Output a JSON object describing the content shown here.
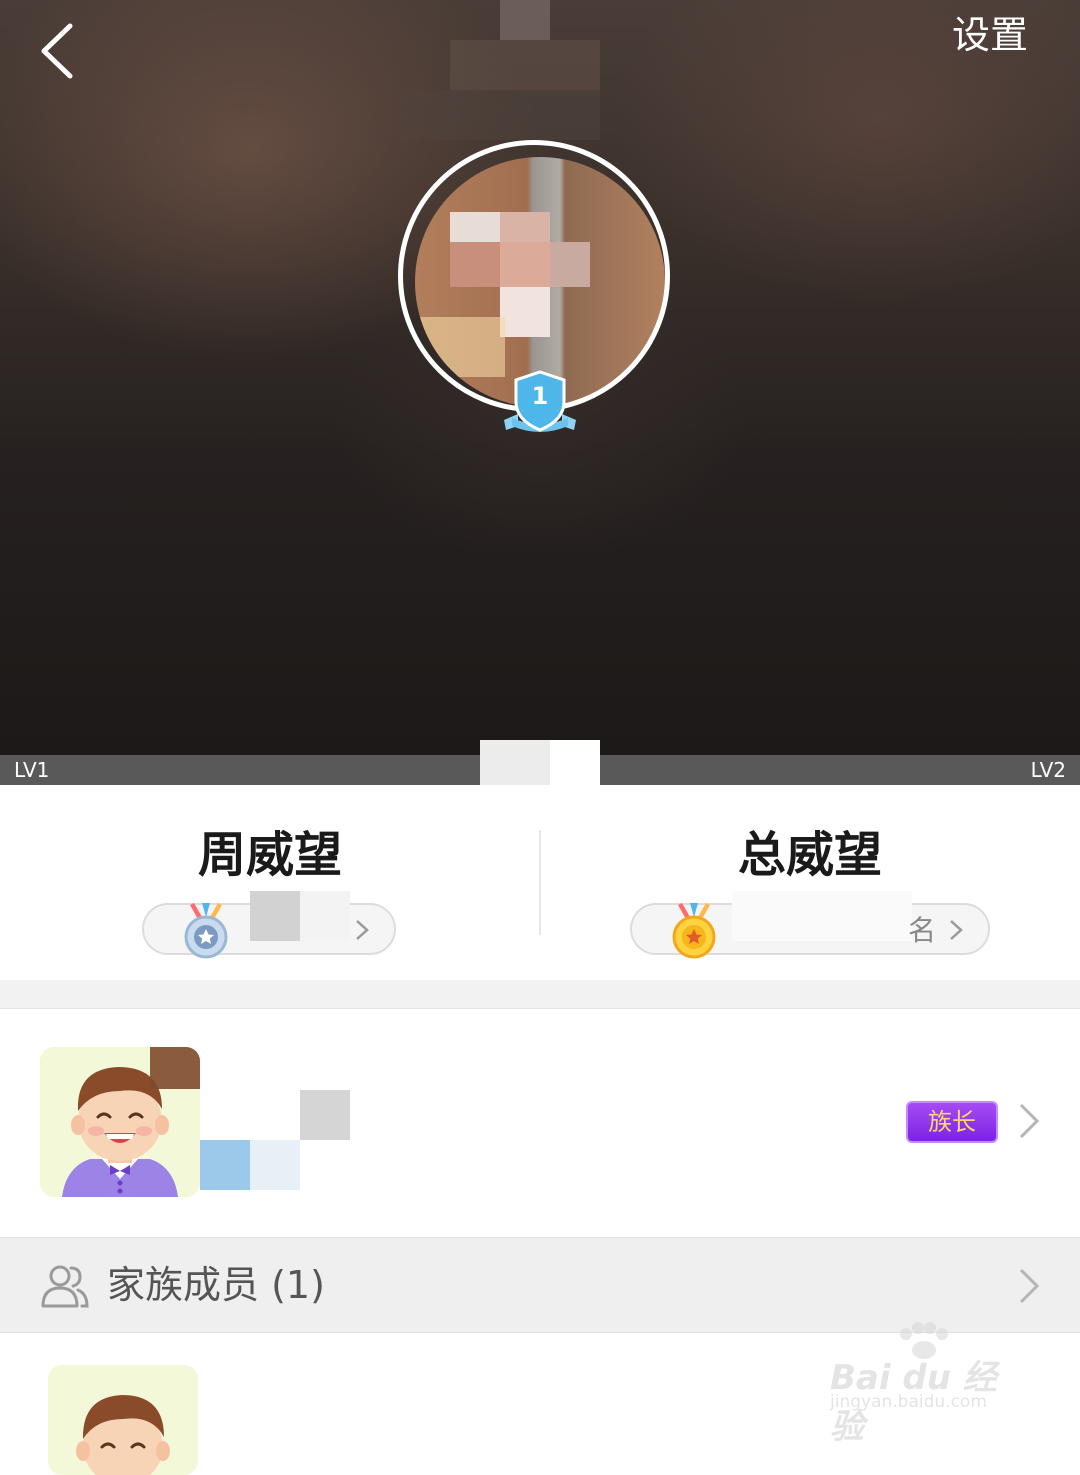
{
  "header": {
    "settings_label": "设置",
    "back_icon": "chevron-left-icon",
    "level_badge_value": "1"
  },
  "level_bar": {
    "left_label": "LV1",
    "right_label": "LV2"
  },
  "prestige": {
    "weekly": {
      "title": "周威望",
      "medal_icon": "silver-medal-icon"
    },
    "total": {
      "title": "总威望",
      "medal_icon": "gold-medal-icon",
      "rank_text_fragment": "名"
    }
  },
  "leader": {
    "badge_label": "族长"
  },
  "members": {
    "label": "家族成员 (1)"
  },
  "watermark": {
    "line1": "Bai du 经验",
    "line2": "jingyan.baidu.com"
  },
  "colors": {
    "header_dark": "#262120",
    "level_bar": "#595959",
    "chief_badge_purple": "#8a2ee8",
    "chief_badge_text": "#ffd76a",
    "level_badge_blue": "#4fb6ea"
  }
}
